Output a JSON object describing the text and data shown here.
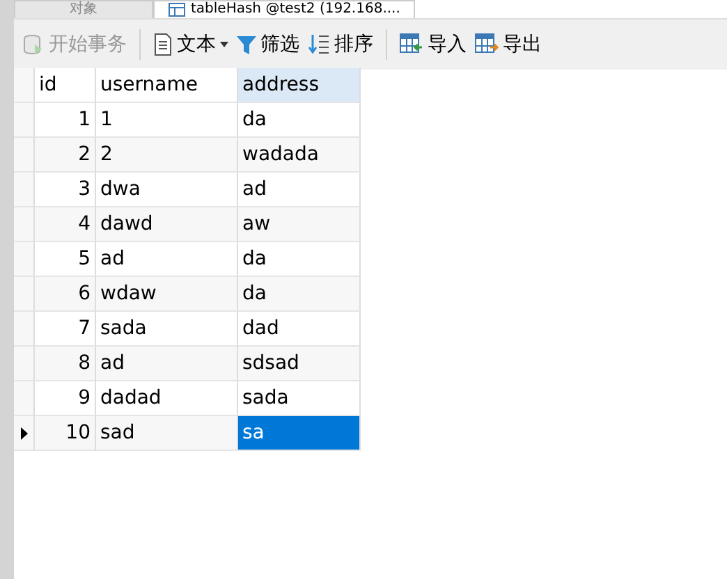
{
  "tabs": [
    {
      "label": "对象",
      "selected": false
    },
    {
      "label": "tableHash @test2 (192.168....",
      "selected": true
    }
  ],
  "toolbar": [
    {
      "kind": "transaction",
      "label": "开始事务",
      "disabled": true
    },
    {
      "kind": "text",
      "label": "文本",
      "disabled": false
    },
    {
      "kind": "filter",
      "label": "筛选",
      "disabled": false
    },
    {
      "kind": "sort",
      "label": "排序",
      "disabled": false
    },
    {
      "kind": "import",
      "label": "导入",
      "disabled": false
    },
    {
      "kind": "export",
      "label": "导出",
      "disabled": false
    }
  ],
  "table": {
    "columns": [
      {
        "label": "id",
        "selected": false
      },
      {
        "label": "username",
        "selected": false
      },
      {
        "label": "address",
        "selected": true
      }
    ],
    "rows": [
      {
        "cells": [
          "1",
          "1",
          "da"
        ],
        "selected": false
      },
      {
        "cells": [
          "2",
          "2",
          "wadada"
        ],
        "selected": false
      },
      {
        "cells": [
          "3",
          "dwa",
          "ad"
        ],
        "selected": false
      },
      {
        "cells": [
          "4",
          "dawd",
          "aw"
        ],
        "selected": false
      },
      {
        "cells": [
          "5",
          "ad",
          "da"
        ],
        "selected": false
      },
      {
        "cells": [
          "6",
          "wdaw",
          "da"
        ],
        "selected": false
      },
      {
        "cells": [
          "7",
          "sada",
          "dad"
        ],
        "selected": false
      },
      {
        "cells": [
          "8",
          "ad",
          "sdsad"
        ],
        "selected": false
      },
      {
        "cells": [
          "9",
          "dadad",
          "sada"
        ],
        "selected": false
      },
      {
        "cells": [
          "10",
          "sad",
          "sa"
        ],
        "selected": true
      }
    ]
  }
}
